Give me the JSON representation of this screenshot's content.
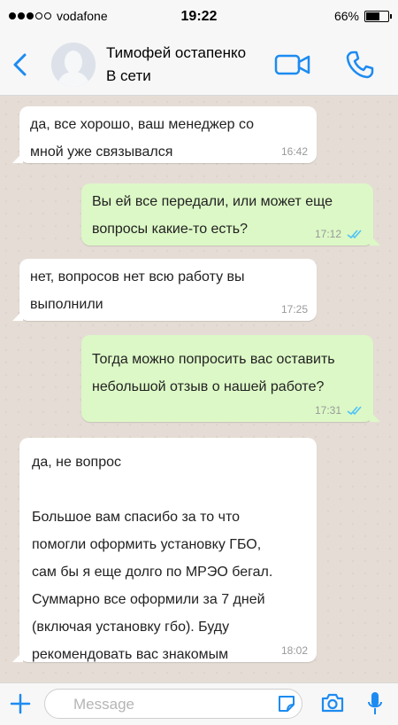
{
  "status_bar": {
    "carrier": "vodafone",
    "time": "19:22",
    "battery": "66%",
    "battery_level": 0.66
  },
  "header": {
    "contact_name": "Тимофей остапенко",
    "contact_status": "В сети"
  },
  "messages": [
    {
      "direction": "incoming",
      "text": "да, все хорошо, ваш менеджер со\nмной уже связывался",
      "time": "16:42"
    },
    {
      "direction": "outgoing",
      "text": "Вы ей все передали, или может еще\nвопросы какие-то есть?",
      "time": "17:12",
      "read": true
    },
    {
      "direction": "incoming",
      "text": "нет, вопросов нет всю работу вы\nвыполнили",
      "time": "17:25"
    },
    {
      "direction": "outgoing",
      "text": "Тогда можно попросить вас оставить\nнебольшой отзыв о нашей работе?",
      "time": "17:31",
      "read": true
    },
    {
      "direction": "incoming",
      "text": "да, не вопрос\n\nБольшое вам спасибо за то что\nпомогли оформить установку ГБО,\nсам бы я еще долго по МРЭО бегал.\nСуммарно все оформили за 7 дней\n(включая установку гбо). Буду\nрекомендовать вас знакомым",
      "time": "18:02"
    }
  ],
  "input": {
    "placeholder": "Message"
  },
  "colors": {
    "accent": "#1d8bf1",
    "incoming_bubble": "#ffffff",
    "outgoing_bubble": "#dcf8c6",
    "chat_background": "#e5ddd5",
    "read_ticks": "#4fc3f7"
  },
  "icons": [
    "back-arrow-icon",
    "avatar-placeholder-icon",
    "video-call-icon",
    "phone-icon",
    "plus-icon",
    "sticker-icon",
    "camera-icon",
    "microphone-icon",
    "double-check-icon"
  ]
}
